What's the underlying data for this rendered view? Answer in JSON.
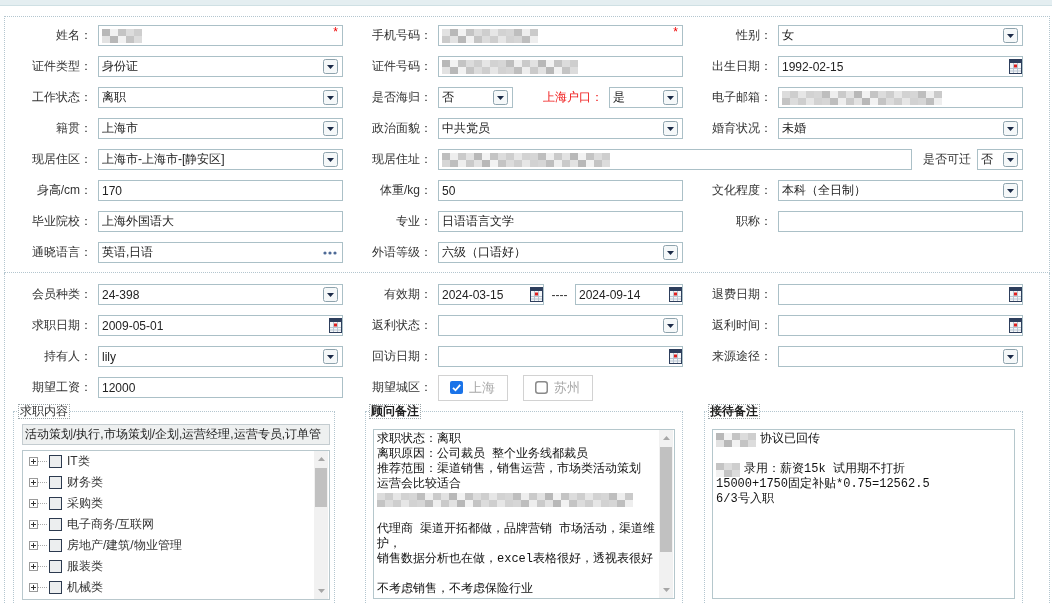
{
  "basic_info": {
    "rows": [
      [
        {
          "label": "姓名：",
          "field": {
            "kind": "text",
            "redacted": true,
            "required_mark": "*"
          }
        },
        {
          "label": "手机号码：",
          "field": {
            "kind": "text",
            "redacted": true,
            "required_mark": "*"
          }
        },
        {
          "label": "性别：",
          "field": {
            "kind": "select",
            "value": "女"
          }
        }
      ],
      [
        {
          "label": "证件类型：",
          "field": {
            "kind": "select",
            "value": "身份证"
          }
        },
        {
          "label": "证件号码：",
          "field": {
            "kind": "text",
            "redacted": true
          }
        },
        {
          "label": "出生日期：",
          "field": {
            "kind": "date",
            "value": "1992-02-15"
          }
        }
      ],
      [
        {
          "label": "工作状态：",
          "field": {
            "kind": "select",
            "value": "离职"
          }
        },
        {
          "label": "是否海归：",
          "field": {
            "kind": "select",
            "value": "否"
          },
          "extra": {
            "label": "上海户口：",
            "emphasized": true,
            "field": {
              "kind": "select",
              "value": "是"
            }
          }
        },
        {
          "label": "电子邮箱：",
          "field": {
            "kind": "text",
            "redacted": true
          }
        }
      ],
      [
        {
          "label": "籍贯：",
          "field": {
            "kind": "select",
            "value": "上海市"
          }
        },
        {
          "label": "政治面貌：",
          "field": {
            "kind": "select",
            "value": "中共党员"
          }
        },
        {
          "label": "婚育状况：",
          "field": {
            "kind": "select",
            "value": "未婚"
          }
        }
      ],
      [
        {
          "label": "现居住区：",
          "field": {
            "kind": "select",
            "value": "上海市-上海市-[静安区]"
          }
        },
        {
          "label": "现居住址：",
          "field": {
            "kind": "text",
            "redacted": true
          },
          "extra": {
            "label": "是否可迁",
            "emphasized": false,
            "field": {
              "kind": "select",
              "value": "否"
            }
          }
        }
      ],
      [
        {
          "label": "身高/cm：",
          "field": {
            "kind": "text",
            "value": "170"
          }
        },
        {
          "label": "体重/kg：",
          "field": {
            "kind": "text",
            "value": "50"
          }
        },
        {
          "label": "文化程度：",
          "field": {
            "kind": "select",
            "value": "本科（全日制）"
          }
        }
      ],
      [
        {
          "label": "毕业院校：",
          "field": {
            "kind": "text",
            "value": "上海外国语大"
          }
        },
        {
          "label": "专业：",
          "field": {
            "kind": "text",
            "value": "日语语言文学"
          }
        },
        {
          "label": "职称：",
          "field": {
            "kind": "text"
          }
        }
      ],
      [
        {
          "label": "通晓语言：",
          "field": {
            "kind": "lookup",
            "value": "英语,日语"
          }
        },
        {
          "label": "外语等级：",
          "field": {
            "kind": "select",
            "value": "六级（口语好）"
          }
        }
      ]
    ]
  },
  "membership": {
    "rows": [
      [
        {
          "label": "会员种类：",
          "field": {
            "kind": "select",
            "value": "24-398"
          }
        },
        {
          "label": "有效期：",
          "field": {
            "kind": "date_range",
            "from": "2024-03-15",
            "separator": "----",
            "to": "2024-09-14"
          }
        },
        {
          "label": "退费日期：",
          "field": {
            "kind": "date"
          }
        }
      ],
      [
        {
          "label": "求职日期：",
          "field": {
            "kind": "date",
            "value": "2009-05-01"
          }
        },
        {
          "label": "返利状态：",
          "field": {
            "kind": "select"
          }
        },
        {
          "label": "返利时间：",
          "field": {
            "kind": "date"
          }
        }
      ],
      [
        {
          "label": "持有人：",
          "field": {
            "kind": "select",
            "value": "lily"
          }
        },
        {
          "label": "回访日期：",
          "field": {
            "kind": "date"
          }
        },
        {
          "label": "来源途径：",
          "field": {
            "kind": "select"
          }
        }
      ],
      [
        {
          "label": "期望工资：",
          "field": {
            "kind": "text",
            "value": "12000"
          }
        },
        {
          "label": "期望城区：",
          "field": {
            "kind": "checkboxes",
            "options": [
              {
                "label": "上海",
                "checked": true
              },
              {
                "label": "苏州",
                "checked": false
              }
            ]
          }
        }
      ]
    ]
  },
  "panels": [
    {
      "kind": "tree",
      "legend": "求职内容",
      "summary": "活动策划/执行,市场策划/企划,运营经理,运营专员,订单管",
      "items": [
        {
          "label": "IT类",
          "expanded": false,
          "checked": false
        },
        {
          "label": "财务类",
          "expanded": false,
          "checked": false
        },
        {
          "label": "采购类",
          "expanded": false,
          "checked": false
        },
        {
          "label": "电子商务/互联网",
          "expanded": false,
          "checked": false
        },
        {
          "label": "房地产/建筑/物业管理",
          "expanded": false,
          "checked": false
        },
        {
          "label": "服装类",
          "expanded": false,
          "checked": false
        },
        {
          "label": "机械类",
          "expanded": false,
          "checked": false
        }
      ]
    },
    {
      "kind": "notes",
      "legend": "顾问备注",
      "lines": [
        {
          "kind": "text",
          "text": "求职状态：离职"
        },
        {
          "kind": "text",
          "text": "离职原因：公司裁员 整个业务线都裁员"
        },
        {
          "kind": "text",
          "text": "推荐范围：渠道销售，销售运营，市场类活动策划"
        },
        {
          "kind": "text",
          "text": "运营会比较适合"
        },
        {
          "kind": "redacted"
        },
        {
          "kind": "blank"
        },
        {
          "kind": "text",
          "text": "代理商 渠道开拓都做，品牌营销 市场活动，渠道维"
        },
        {
          "kind": "text",
          "text": "护，"
        },
        {
          "kind": "text",
          "text": "销售数据分析也在做，excel表格很好，透视表很好"
        },
        {
          "kind": "blank"
        },
        {
          "kind": "text",
          "text": "不考虑销售，不考虑保险行业"
        }
      ]
    },
    {
      "kind": "notes",
      "legend": "接待备注",
      "lines": [
        {
          "kind": "redacted_text",
          "text": "协议已回传"
        },
        {
          "kind": "blank"
        },
        {
          "kind": "redacted_text",
          "text": "录用：薪资15k 试用期不打折"
        },
        {
          "kind": "text",
          "text": "15000+1750固定补贴*0.75=12562.5"
        },
        {
          "kind": "text",
          "text": "6/3号入职"
        }
      ]
    }
  ]
}
